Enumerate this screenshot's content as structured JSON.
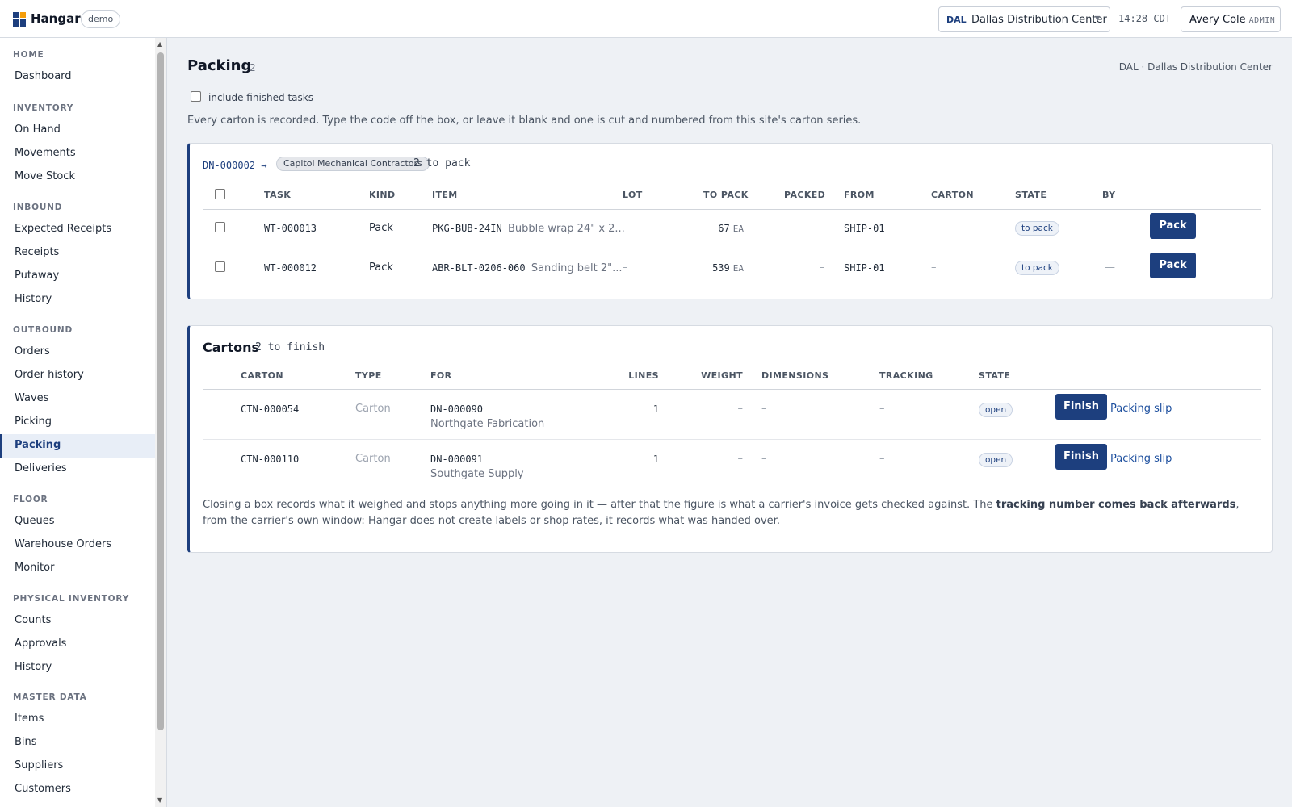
{
  "app": {
    "name": "Hangar",
    "env_badge": "demo"
  },
  "site": {
    "code": "DAL",
    "name": "Dallas Distribution Center"
  },
  "clock": "14:28 CDT",
  "user": {
    "name": "Avery Cole",
    "role": "ADMIN"
  },
  "sidebar": {
    "sections": [
      {
        "heading": "HOME",
        "items": [
          "Dashboard"
        ]
      },
      {
        "heading": "INVENTORY",
        "items": [
          "On Hand",
          "Movements",
          "Move Stock"
        ]
      },
      {
        "heading": "INBOUND",
        "items": [
          "Expected Receipts",
          "Receipts",
          "Putaway",
          "History"
        ]
      },
      {
        "heading": "OUTBOUND",
        "items": [
          "Orders",
          "Order history",
          "Waves",
          "Picking",
          "Packing",
          "Deliveries"
        ]
      },
      {
        "heading": "FLOOR",
        "items": [
          "Queues",
          "Warehouse Orders",
          "Monitor"
        ]
      },
      {
        "heading": "PHYSICAL INVENTORY",
        "items": [
          "Counts",
          "Approvals",
          "History"
        ]
      },
      {
        "heading": "MASTER DATA",
        "items": [
          "Items",
          "Bins",
          "Suppliers",
          "Customers"
        ]
      }
    ],
    "active_item": "Packing"
  },
  "page": {
    "title": "Packing",
    "count": "2",
    "site_label": "DAL · Dallas Distribution Center",
    "include_finished_label": "include finished tasks",
    "include_finished_checked": false,
    "intro": "Every carton is recorded. Type the code off the box, or leave it blank and one is cut and numbered from this site's carton series."
  },
  "delivery_group": {
    "delivery_number": "DN-000002",
    "arrow": "→",
    "customer": "Capitol Mechanical Contractors",
    "summary": "2 to pack",
    "columns": [
      "TASK",
      "KIND",
      "ITEM",
      "LOT",
      "TO PACK",
      "PACKED",
      "FROM",
      "CARTON",
      "STATE",
      "BY"
    ],
    "rows": [
      {
        "task": "WT-000013",
        "kind": "Pack",
        "item_code": "PKG-BUB-24IN",
        "item_desc": "Bubble wrap 24\" x 2...",
        "lot": "–",
        "to_pack": "67",
        "uom": "EA",
        "packed": "–",
        "from": "SHIP-01",
        "carton": "–",
        "state": "to pack",
        "by": "—",
        "action": "Pack"
      },
      {
        "task": "WT-000012",
        "kind": "Pack",
        "item_code": "ABR-BLT-0206-060",
        "item_desc": "Sanding belt 2\"...",
        "lot": "–",
        "to_pack": "539",
        "uom": "EA",
        "packed": "–",
        "from": "SHIP-01",
        "carton": "–",
        "state": "to pack",
        "by": "—",
        "action": "Pack"
      }
    ]
  },
  "cartons": {
    "title": "Cartons",
    "summary": "2 to finish",
    "columns": [
      "CARTON",
      "TYPE",
      "FOR",
      "LINES",
      "WEIGHT",
      "DIMENSIONS",
      "TRACKING",
      "STATE"
    ],
    "rows": [
      {
        "carton": "CTN-000054",
        "type": "Carton",
        "for_dn": "DN-000090",
        "for_customer": "Northgate Fabrication",
        "lines": "1",
        "weight": "–",
        "dimensions": "–",
        "tracking": "–",
        "state": "open",
        "action": "Finish",
        "slip": "Packing slip"
      },
      {
        "carton": "CTN-000110",
        "type": "Carton",
        "for_dn": "DN-000091",
        "for_customer": "Southgate Supply",
        "lines": "1",
        "weight": "–",
        "dimensions": "–",
        "tracking": "–",
        "state": "open",
        "action": "Finish",
        "slip": "Packing slip"
      }
    ],
    "footnote_a": "Closing a box records what it weighed and stops anything more going in it — after that the figure is what a carrier's invoice gets checked against. The ",
    "footnote_bold": "tracking number comes back afterwards",
    "footnote_b": ", from the carrier's own window: Hangar does not create labels or shop rates, it records what was handed over."
  },
  "colors": {
    "accent": "#1d3f7e",
    "page_bg": "#eef1f5"
  }
}
